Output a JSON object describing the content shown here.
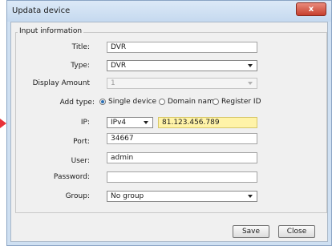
{
  "window": {
    "title": "Updata device",
    "close_glyph": "x"
  },
  "group": {
    "legend": "Input information"
  },
  "form": {
    "title_label": "Title:",
    "title_value": "DVR",
    "type_label": "Type:",
    "type_value": "DVR",
    "display_amount_label": "Display Amount",
    "display_amount_value": "1",
    "add_type_label": "Add type:",
    "add_type_options": [
      "Single device",
      "Domain name",
      "Register ID"
    ],
    "add_type_selected": "Single device",
    "ip_label": "IP:",
    "ip_version": "IPv4",
    "ip_value": "81.123.456.789",
    "port_label": "Port:",
    "port_value": "34667",
    "user_label": "User:",
    "user_value": "admin",
    "password_label": "Password:",
    "password_value": "",
    "group_label": "Group:",
    "group_value": "No group"
  },
  "buttons": {
    "save": "Save",
    "close": "Close"
  },
  "colors": {
    "ip_highlight": "#fff3a8",
    "arrow": "#e8323a",
    "close_button": "#c7402e"
  }
}
